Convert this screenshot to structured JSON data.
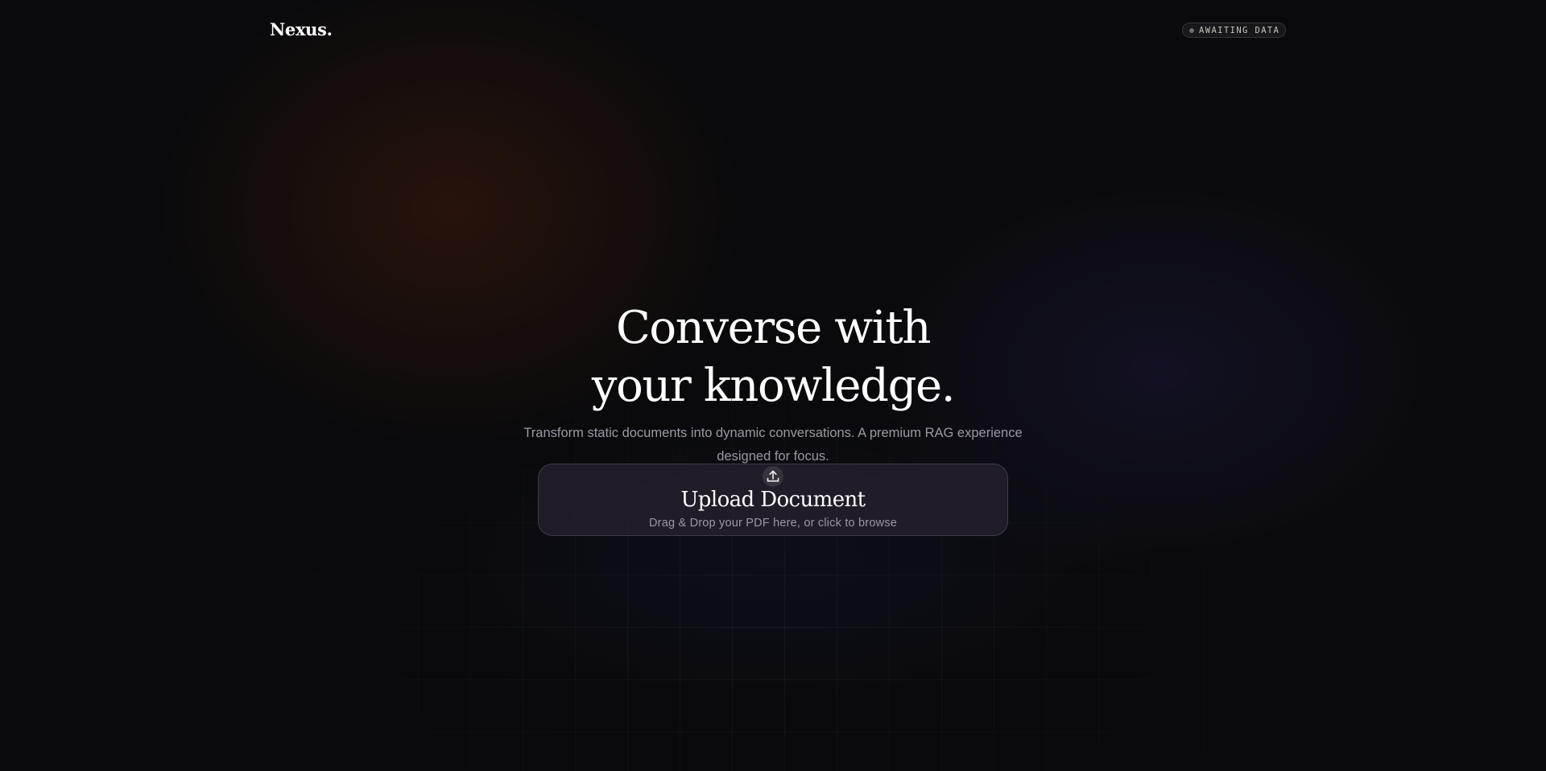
{
  "header": {
    "logo": "Nexus.",
    "status": {
      "label": "AWAITING DATA",
      "dot_color": "#6d6d73"
    }
  },
  "hero": {
    "title_line_1": "Converse with",
    "title_line_2": "your knowledge.",
    "subtitle": "Transform static documents into dynamic conversations. A premium RAG experience designed for focus."
  },
  "upload": {
    "icon": "upload-icon",
    "title": "Upload Document",
    "hint": "Drag & Drop your PDF here, or click to browse"
  },
  "colors": {
    "background": "#0a0a0c",
    "warm_glow": "#50200a",
    "cool_glow": "#201c48",
    "text_primary": "#ffffff",
    "text_muted": "#9b98a3"
  }
}
